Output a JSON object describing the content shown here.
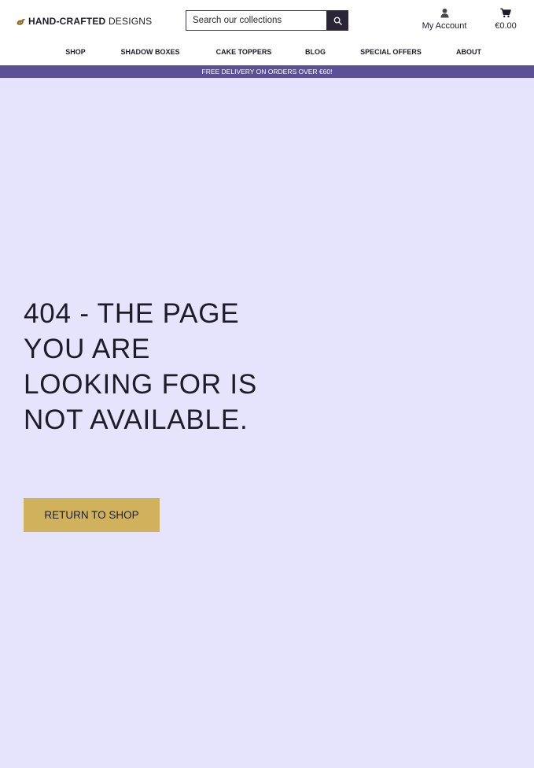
{
  "header": {
    "logo": {
      "brand_bold": "HAND-CRAFTED",
      "brand_light": "DESIGNS",
      "icon": "logo-mark-icon"
    },
    "search": {
      "placeholder": "Search our collections",
      "value": "",
      "icon": "search-icon"
    },
    "account": {
      "label": "My Account",
      "icon": "user-icon"
    },
    "cart": {
      "total": "€0.00",
      "icon": "cart-icon"
    }
  },
  "nav": {
    "items": [
      {
        "label": "SHOP"
      },
      {
        "label": "SHADOW BOXES"
      },
      {
        "label": "CAKE TOPPERS"
      },
      {
        "label": "BLOG"
      },
      {
        "label": "SPECIAL OFFERS"
      },
      {
        "label": "ABOUT"
      }
    ]
  },
  "promo": {
    "text": "FREE DELIVERY ON ORDERS OVER €60!"
  },
  "main": {
    "error_title": "404 - THE PAGE YOU ARE LOOKING FOR IS NOT AVAILABLE.",
    "return_button": "RETURN TO SHOP"
  },
  "colors": {
    "page_background": "#e6e4fc",
    "promo_bar": "#5b4f96",
    "button_gold": "#d0b25c",
    "dark_text": "#1f1c2a"
  }
}
